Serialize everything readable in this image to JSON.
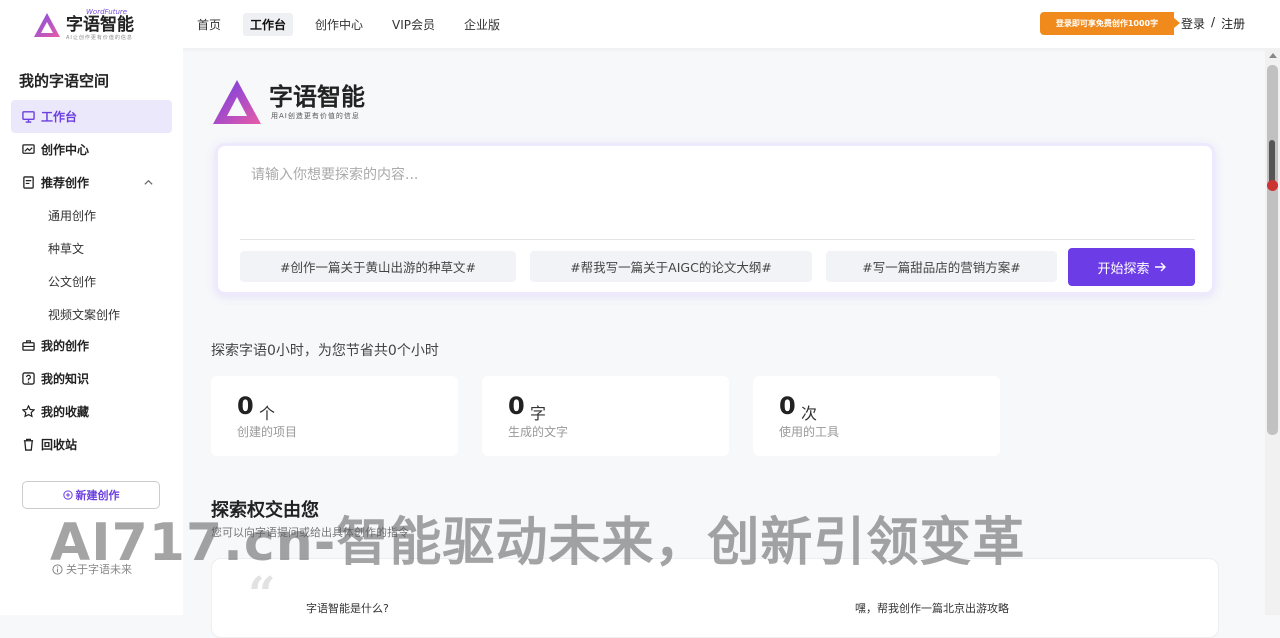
{
  "header": {
    "logo_en": "WordFuture",
    "logo_cn": "字语智能",
    "logo_sub": "AI让创作更有价值的信息",
    "nav": [
      "首页",
      "工作台",
      "创作中心",
      "VIP会员",
      "企业版"
    ],
    "active_nav": 1,
    "promo": "登录即可享免费创作1000字",
    "login": "登录",
    "separator": "/",
    "register": "注册"
  },
  "sidebar": {
    "title": "我的字语空间",
    "items": [
      {
        "label": "工作台",
        "icon": "monitor-icon"
      },
      {
        "label": "创作中心",
        "icon": "chart-icon"
      },
      {
        "label": "推荐创作",
        "icon": "document-icon"
      },
      {
        "label": "我的创作",
        "icon": "briefcase-icon"
      },
      {
        "label": "我的知识",
        "icon": "question-icon"
      },
      {
        "label": "我的收藏",
        "icon": "star-icon"
      },
      {
        "label": "回收站",
        "icon": "trash-icon"
      }
    ],
    "subitems": [
      "通用创作",
      "种草文",
      "公文创作",
      "视频文案创作"
    ],
    "new_button": "新建创作",
    "about": "关于字语未来"
  },
  "main": {
    "brand_cn": "字语智能",
    "brand_sub": "用AI创造更有价值的信息",
    "search_placeholder": "请输入你想要探索的内容...",
    "tags": [
      "#创作一篇关于黄山出游的种草文#",
      "#帮我写一篇关于AIGC的论文大纲#",
      "#写一篇甜品店的营销方案#"
    ],
    "start_button": "开始探索",
    "saved_text": "探索字语0小时，为您节省共0个小时",
    "stats": [
      {
        "value": "0",
        "unit": "个",
        "label": "创建的项目"
      },
      {
        "value": "0",
        "unit": "字",
        "label": "生成的文字"
      },
      {
        "value": "0",
        "unit": "次",
        "label": "使用的工具"
      }
    ],
    "section_title": "探索权交由您",
    "section_sub": "您可以向字语提问或给出具体创作的指令",
    "quote_mark": "“",
    "question_left": "字语智能是什么?",
    "question_right": "嘿，帮我创作一篇北京出游攻略"
  },
  "watermark": "AI717.cn-智能驱动未来，创新引领变革",
  "colors": {
    "accent": "#6c3ce6",
    "promo": "#f08a1c",
    "active_bg": "#ece8fb"
  }
}
